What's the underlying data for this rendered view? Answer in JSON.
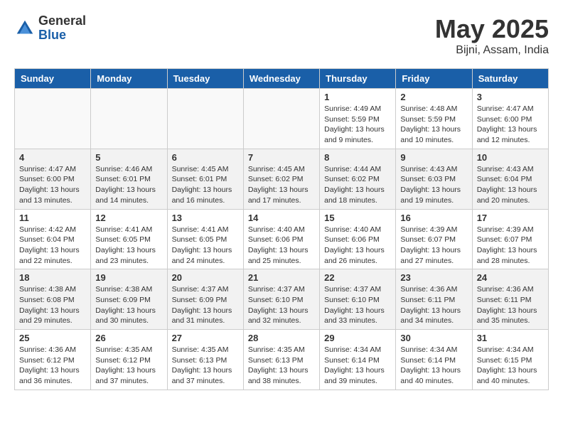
{
  "header": {
    "logo_general": "General",
    "logo_blue": "Blue",
    "title": "May 2025",
    "location": "Bijni, Assam, India"
  },
  "days_of_week": [
    "Sunday",
    "Monday",
    "Tuesday",
    "Wednesday",
    "Thursday",
    "Friday",
    "Saturday"
  ],
  "weeks": [
    [
      {
        "day": "",
        "empty": true
      },
      {
        "day": "",
        "empty": true
      },
      {
        "day": "",
        "empty": true
      },
      {
        "day": "",
        "empty": true
      },
      {
        "day": "1",
        "sunrise": "4:49 AM",
        "sunset": "5:59 PM",
        "daylight": "13 hours and 9 minutes."
      },
      {
        "day": "2",
        "sunrise": "4:48 AM",
        "sunset": "5:59 PM",
        "daylight": "13 hours and 10 minutes."
      },
      {
        "day": "3",
        "sunrise": "4:47 AM",
        "sunset": "6:00 PM",
        "daylight": "13 hours and 12 minutes."
      }
    ],
    [
      {
        "day": "4",
        "sunrise": "4:47 AM",
        "sunset": "6:00 PM",
        "daylight": "13 hours and 13 minutes."
      },
      {
        "day": "5",
        "sunrise": "4:46 AM",
        "sunset": "6:01 PM",
        "daylight": "13 hours and 14 minutes."
      },
      {
        "day": "6",
        "sunrise": "4:45 AM",
        "sunset": "6:01 PM",
        "daylight": "13 hours and 16 minutes."
      },
      {
        "day": "7",
        "sunrise": "4:45 AM",
        "sunset": "6:02 PM",
        "daylight": "13 hours and 17 minutes."
      },
      {
        "day": "8",
        "sunrise": "4:44 AM",
        "sunset": "6:02 PM",
        "daylight": "13 hours and 18 minutes."
      },
      {
        "day": "9",
        "sunrise": "4:43 AM",
        "sunset": "6:03 PM",
        "daylight": "13 hours and 19 minutes."
      },
      {
        "day": "10",
        "sunrise": "4:43 AM",
        "sunset": "6:04 PM",
        "daylight": "13 hours and 20 minutes."
      }
    ],
    [
      {
        "day": "11",
        "sunrise": "4:42 AM",
        "sunset": "6:04 PM",
        "daylight": "13 hours and 22 minutes."
      },
      {
        "day": "12",
        "sunrise": "4:41 AM",
        "sunset": "6:05 PM",
        "daylight": "13 hours and 23 minutes."
      },
      {
        "day": "13",
        "sunrise": "4:41 AM",
        "sunset": "6:05 PM",
        "daylight": "13 hours and 24 minutes."
      },
      {
        "day": "14",
        "sunrise": "4:40 AM",
        "sunset": "6:06 PM",
        "daylight": "13 hours and 25 minutes."
      },
      {
        "day": "15",
        "sunrise": "4:40 AM",
        "sunset": "6:06 PM",
        "daylight": "13 hours and 26 minutes."
      },
      {
        "day": "16",
        "sunrise": "4:39 AM",
        "sunset": "6:07 PM",
        "daylight": "13 hours and 27 minutes."
      },
      {
        "day": "17",
        "sunrise": "4:39 AM",
        "sunset": "6:07 PM",
        "daylight": "13 hours and 28 minutes."
      }
    ],
    [
      {
        "day": "18",
        "sunrise": "4:38 AM",
        "sunset": "6:08 PM",
        "daylight": "13 hours and 29 minutes."
      },
      {
        "day": "19",
        "sunrise": "4:38 AM",
        "sunset": "6:09 PM",
        "daylight": "13 hours and 30 minutes."
      },
      {
        "day": "20",
        "sunrise": "4:37 AM",
        "sunset": "6:09 PM",
        "daylight": "13 hours and 31 minutes."
      },
      {
        "day": "21",
        "sunrise": "4:37 AM",
        "sunset": "6:10 PM",
        "daylight": "13 hours and 32 minutes."
      },
      {
        "day": "22",
        "sunrise": "4:37 AM",
        "sunset": "6:10 PM",
        "daylight": "13 hours and 33 minutes."
      },
      {
        "day": "23",
        "sunrise": "4:36 AM",
        "sunset": "6:11 PM",
        "daylight": "13 hours and 34 minutes."
      },
      {
        "day": "24",
        "sunrise": "4:36 AM",
        "sunset": "6:11 PM",
        "daylight": "13 hours and 35 minutes."
      }
    ],
    [
      {
        "day": "25",
        "sunrise": "4:36 AM",
        "sunset": "6:12 PM",
        "daylight": "13 hours and 36 minutes."
      },
      {
        "day": "26",
        "sunrise": "4:35 AM",
        "sunset": "6:12 PM",
        "daylight": "13 hours and 37 minutes."
      },
      {
        "day": "27",
        "sunrise": "4:35 AM",
        "sunset": "6:13 PM",
        "daylight": "13 hours and 37 minutes."
      },
      {
        "day": "28",
        "sunrise": "4:35 AM",
        "sunset": "6:13 PM",
        "daylight": "13 hours and 38 minutes."
      },
      {
        "day": "29",
        "sunrise": "4:34 AM",
        "sunset": "6:14 PM",
        "daylight": "13 hours and 39 minutes."
      },
      {
        "day": "30",
        "sunrise": "4:34 AM",
        "sunset": "6:14 PM",
        "daylight": "13 hours and 40 minutes."
      },
      {
        "day": "31",
        "sunrise": "4:34 AM",
        "sunset": "6:15 PM",
        "daylight": "13 hours and 40 minutes."
      }
    ]
  ]
}
